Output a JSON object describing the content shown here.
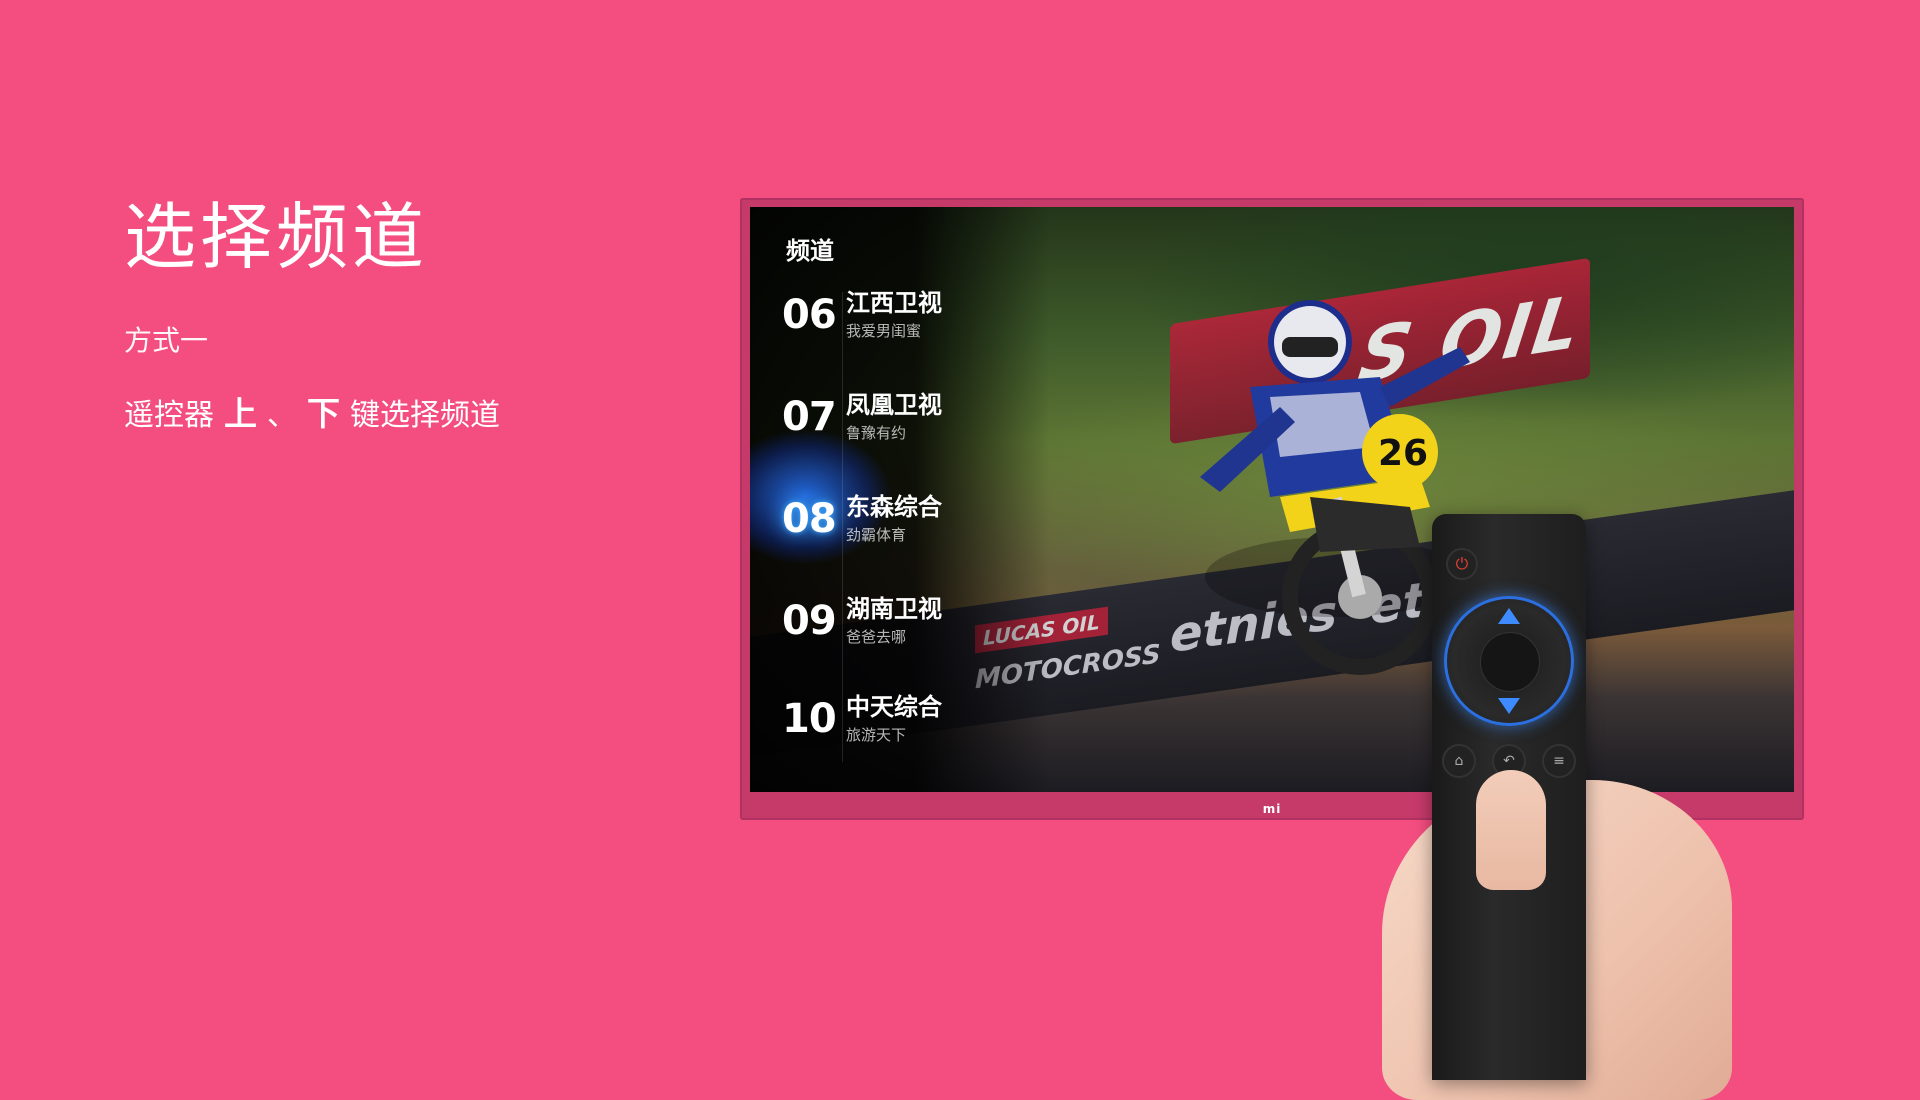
{
  "intro": {
    "title": "选择频道",
    "method": "方式一",
    "instr_prefix": "遥控器",
    "key_up": "上",
    "separator": "、",
    "key_down": "下",
    "instr_suffix": "键选择频道"
  },
  "tv": {
    "overlay_heading": "频道",
    "channels": [
      {
        "num": "06",
        "name": "江西卫视",
        "program": "我爱男闺蜜"
      },
      {
        "num": "07",
        "name": "凤凰卫视",
        "program": "鲁豫有约"
      },
      {
        "num": "08",
        "name": "东森综合",
        "program": "劲霸体育"
      },
      {
        "num": "09",
        "name": "湖南卫视",
        "program": "爸爸去哪"
      },
      {
        "num": "10",
        "name": "中天综合",
        "program": "旅游天下"
      }
    ],
    "active_channel": "08",
    "brand_logo": "mi",
    "banner_text": "S OIL",
    "ads": [
      "etnies",
      "LUCAS OIL",
      "MOTOCROSS",
      "etnies"
    ]
  },
  "remote": {
    "buttons": [
      "power-icon",
      "dpad-up-icon",
      "dpad-down-icon",
      "home-icon",
      "back-icon",
      "menu-icon"
    ]
  },
  "colors": {
    "background": "#f44e81",
    "accent_blue": "#3d8bff",
    "power_red": "#e43f32"
  }
}
